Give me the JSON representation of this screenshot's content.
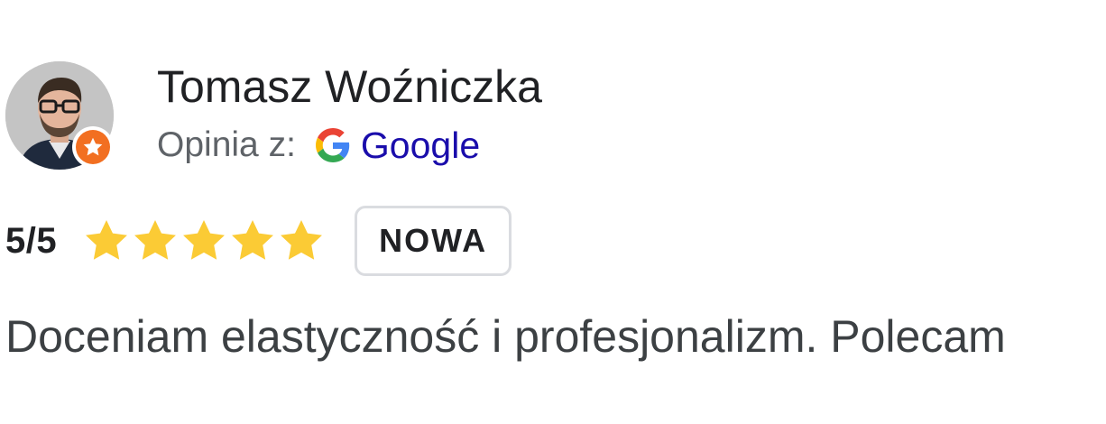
{
  "review": {
    "reviewer_name": "Tomasz Woźniczka",
    "source_label": "Opinia z:",
    "source_name": "Google",
    "rating_text": "5/5",
    "rating": 5,
    "rating_max": 5,
    "badge": "NOWA",
    "text": "Doceniam elastyczność i profesjonalizm. Polecam"
  },
  "icons": {
    "avatar": "reviewer-photo",
    "badge_icon": "local-guide-star-icon",
    "source_icon": "google-g-icon",
    "star_icon": "star-icon"
  },
  "colors": {
    "star": "#fbcb35",
    "link": "#1a0dab",
    "local_guide": "#f26f21",
    "badge_border": "#dadce0"
  }
}
